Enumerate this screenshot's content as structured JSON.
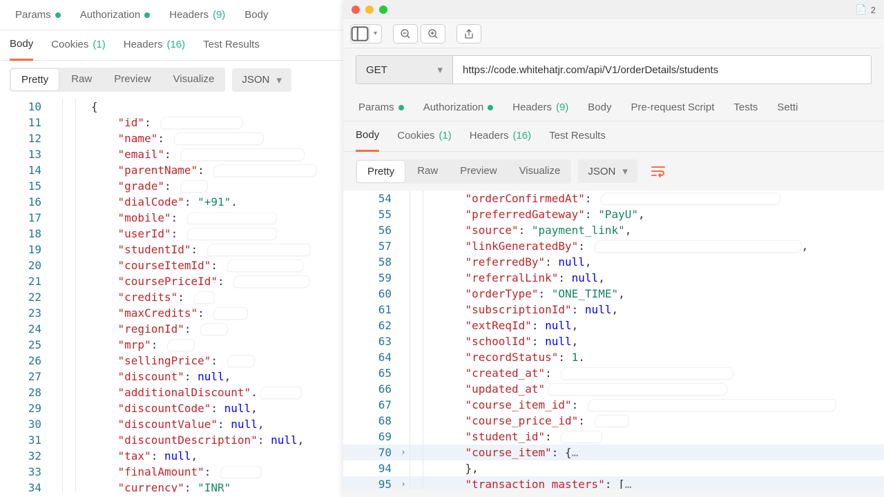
{
  "left": {
    "reqTabs": {
      "params": "Params",
      "authorization": "Authorization",
      "headers": "Headers",
      "headersCount": "(9)",
      "body": "Body"
    },
    "respTabs": {
      "body": "Body",
      "cookies": "Cookies",
      "cookiesCount": "(1)",
      "headers": "Headers",
      "headersCount": "(16)",
      "testResults": "Test Results"
    },
    "viewOpts": {
      "pretty": "Pretty",
      "raw": "Raw",
      "preview": "Preview",
      "visualize": "Visualize",
      "format": "JSON"
    },
    "lines": [
      {
        "n": 10,
        "indent": 3,
        "tokens": [
          {
            "p": "{"
          }
        ]
      },
      {
        "n": 11,
        "indent": 4,
        "tokens": [
          {
            "k": "\"id\""
          },
          {
            "p": ": "
          }
        ],
        "smudge": 120
      },
      {
        "n": 12,
        "indent": 4,
        "tokens": [
          {
            "k": "\"name\""
          },
          {
            "p": ": "
          }
        ],
        "smudge": 130
      },
      {
        "n": 13,
        "indent": 4,
        "tokens": [
          {
            "k": "\"email\""
          },
          {
            "p": ": "
          }
        ],
        "smudge": 180
      },
      {
        "n": 14,
        "indent": 4,
        "tokens": [
          {
            "k": "\"parentName\""
          },
          {
            "p": ": "
          }
        ],
        "smudge": 150
      },
      {
        "n": 15,
        "indent": 4,
        "tokens": [
          {
            "k": "\"grade\""
          },
          {
            "p": ": "
          }
        ],
        "smudge": 40
      },
      {
        "n": 16,
        "indent": 4,
        "tokens": [
          {
            "k": "\"dialCode\""
          },
          {
            "p": ": "
          },
          {
            "s": "\"+91\""
          },
          {
            "p": "."
          }
        ]
      },
      {
        "n": 17,
        "indent": 4,
        "tokens": [
          {
            "k": "\"mobile\""
          },
          {
            "p": ": "
          }
        ],
        "smudge": 130
      },
      {
        "n": 18,
        "indent": 4,
        "tokens": [
          {
            "k": "\"userId\""
          },
          {
            "p": ": "
          }
        ],
        "smudge": 130
      },
      {
        "n": 19,
        "indent": 4,
        "tokens": [
          {
            "k": "\"studentId\""
          },
          {
            "p": ": "
          }
        ],
        "smudge": 150
      },
      {
        "n": 20,
        "indent": 4,
        "tokens": [
          {
            "k": "\"courseItemId\""
          },
          {
            "p": ": "
          }
        ],
        "smudge": 110
      },
      {
        "n": 21,
        "indent": 4,
        "tokens": [
          {
            "k": "\"coursePriceId\""
          },
          {
            "p": ": "
          }
        ],
        "smudge": 110
      },
      {
        "n": 22,
        "indent": 4,
        "tokens": [
          {
            "k": "\"credits\""
          },
          {
            "p": ": "
          }
        ],
        "smudge": 30
      },
      {
        "n": 23,
        "indent": 4,
        "tokens": [
          {
            "k": "\"maxCredits\""
          },
          {
            "p": ": "
          }
        ],
        "smudge": 50
      },
      {
        "n": 24,
        "indent": 4,
        "tokens": [
          {
            "k": "\"regionId\""
          },
          {
            "p": ": "
          }
        ],
        "smudge": 40
      },
      {
        "n": 25,
        "indent": 4,
        "tokens": [
          {
            "k": "\"mrp\""
          },
          {
            "p": ": "
          }
        ],
        "smudge": 40
      },
      {
        "n": 26,
        "indent": 4,
        "tokens": [
          {
            "k": "\"sellingPrice\""
          },
          {
            "p": ": "
          }
        ],
        "smudge": 40
      },
      {
        "n": 27,
        "indent": 4,
        "tokens": [
          {
            "k": "\"discount\""
          },
          {
            "p": ": "
          },
          {
            "null": "null"
          },
          {
            "p": ","
          }
        ]
      },
      {
        "n": 28,
        "indent": 4,
        "tokens": [
          {
            "k": "\"additionalDiscount\""
          },
          {
            "p": "."
          }
        ],
        "smudge": 60
      },
      {
        "n": 29,
        "indent": 4,
        "tokens": [
          {
            "k": "\"discountCode\""
          },
          {
            "p": ": "
          },
          {
            "null": "null"
          },
          {
            "p": ","
          }
        ]
      },
      {
        "n": 30,
        "indent": 4,
        "tokens": [
          {
            "k": "\"discountValue\""
          },
          {
            "p": ": "
          },
          {
            "null": "null"
          },
          {
            "p": ","
          }
        ]
      },
      {
        "n": 31,
        "indent": 4,
        "tokens": [
          {
            "k": "\"discountDescription\""
          },
          {
            "p": ": "
          },
          {
            "null": "null"
          },
          {
            "p": ","
          }
        ]
      },
      {
        "n": 32,
        "indent": 4,
        "tokens": [
          {
            "k": "\"tax\""
          },
          {
            "p": ": "
          },
          {
            "null": "null"
          },
          {
            "p": ","
          }
        ]
      },
      {
        "n": 33,
        "indent": 4,
        "tokens": [
          {
            "k": "\"finalAmount\""
          },
          {
            "p": ": "
          }
        ],
        "smudge": 60
      },
      {
        "n": 34,
        "indent": 4,
        "tokens": [
          {
            "k": "\"currency\""
          },
          {
            "p": ": "
          },
          {
            "s": "\"INR\""
          }
        ]
      }
    ]
  },
  "right": {
    "titlebar": {
      "count": "2"
    },
    "method": "GET",
    "url": "https://code.whitehatjr.com/api/V1/orderDetails/students",
    "reqTabs": {
      "params": "Params",
      "authorization": "Authorization",
      "headers": "Headers",
      "headersCount": "(9)",
      "body": "Body",
      "preRequest": "Pre-request Script",
      "tests": "Tests",
      "settings": "Setti"
    },
    "respTabs": {
      "body": "Body",
      "cookies": "Cookies",
      "cookiesCount": "(1)",
      "headers": "Headers",
      "headersCount": "(16)",
      "testResults": "Test Results"
    },
    "viewOpts": {
      "pretty": "Pretty",
      "raw": "Raw",
      "preview": "Preview",
      "visualize": "Visualize",
      "format": "JSON"
    },
    "lines": [
      {
        "n": 54,
        "indent": 4,
        "tokens": [
          {
            "k": "\"orderConfirmedAt\""
          },
          {
            "p": ": "
          }
        ],
        "smudge": 260
      },
      {
        "n": 55,
        "indent": 4,
        "tokens": [
          {
            "k": "\"preferredGateway\""
          },
          {
            "p": ": "
          },
          {
            "s": "\"PayU\""
          },
          {
            "p": ","
          }
        ]
      },
      {
        "n": 56,
        "indent": 4,
        "tokens": [
          {
            "k": "\"source\""
          },
          {
            "p": ": "
          },
          {
            "s": "\"payment_link\""
          },
          {
            "p": ","
          }
        ]
      },
      {
        "n": 57,
        "indent": 4,
        "tokens": [
          {
            "k": "\"linkGeneratedBy\""
          },
          {
            "p": ": "
          }
        ],
        "smudge": 300,
        "trail": ","
      },
      {
        "n": 58,
        "indent": 4,
        "tokens": [
          {
            "k": "\"referredBy\""
          },
          {
            "p": ": "
          },
          {
            "null": "null"
          },
          {
            "p": ","
          }
        ]
      },
      {
        "n": 59,
        "indent": 4,
        "tokens": [
          {
            "k": "\"referralLink\""
          },
          {
            "p": ": "
          },
          {
            "null": "null"
          },
          {
            "p": ","
          }
        ]
      },
      {
        "n": 60,
        "indent": 4,
        "tokens": [
          {
            "k": "\"orderType\""
          },
          {
            "p": ": "
          },
          {
            "s": "\"ONE_TIME\""
          },
          {
            "p": ","
          }
        ]
      },
      {
        "n": 61,
        "indent": 4,
        "tokens": [
          {
            "k": "\"subscriptionId\""
          },
          {
            "p": ": "
          },
          {
            "null": "null"
          },
          {
            "p": ","
          }
        ]
      },
      {
        "n": 62,
        "indent": 4,
        "tokens": [
          {
            "k": "\"extReqId\""
          },
          {
            "p": ": "
          },
          {
            "null": "null"
          },
          {
            "p": ","
          }
        ]
      },
      {
        "n": 63,
        "indent": 4,
        "tokens": [
          {
            "k": "\"schoolId\""
          },
          {
            "p": ": "
          },
          {
            "null": "null"
          },
          {
            "p": ","
          }
        ]
      },
      {
        "n": 64,
        "indent": 4,
        "tokens": [
          {
            "k": "\"recordStatus\""
          },
          {
            "p": ": "
          },
          {
            "num": "1"
          },
          {
            "p": "."
          }
        ]
      },
      {
        "n": 65,
        "indent": 4,
        "tokens": [
          {
            "k": "\"created_at\""
          },
          {
            "p": ": "
          }
        ],
        "smudge": 250
      },
      {
        "n": 66,
        "indent": 4,
        "tokens": [
          {
            "k": "\"updated_at\""
          },
          {
            "p": ""
          }
        ],
        "smudge": 260
      },
      {
        "n": 67,
        "indent": 4,
        "tokens": [
          {
            "k": "\"course_item_id\""
          },
          {
            "p": ": "
          }
        ],
        "smudge": 360
      },
      {
        "n": 68,
        "indent": 4,
        "tokens": [
          {
            "k": "\"course_price_id\""
          },
          {
            "p": ": "
          }
        ],
        "smudge": 50
      },
      {
        "n": 69,
        "indent": 4,
        "tokens": [
          {
            "k": "\"student_id\""
          },
          {
            "p": ": "
          }
        ],
        "smudge": 60
      },
      {
        "n": 70,
        "indent": 4,
        "fold": true,
        "hl": true,
        "tokens": [
          {
            "k": "\"course_item\""
          },
          {
            "p": ": {"
          },
          {
            "ell": "…"
          }
        ]
      },
      {
        "n": 94,
        "indent": 4,
        "tokens": [
          {
            "p": "},"
          }
        ]
      },
      {
        "n": 95,
        "indent": 4,
        "fold": true,
        "hl": true,
        "tokens": [
          {
            "k": "\"transaction_masters\""
          },
          {
            "p": ": ["
          },
          {
            "ell": "…"
          }
        ]
      }
    ]
  }
}
